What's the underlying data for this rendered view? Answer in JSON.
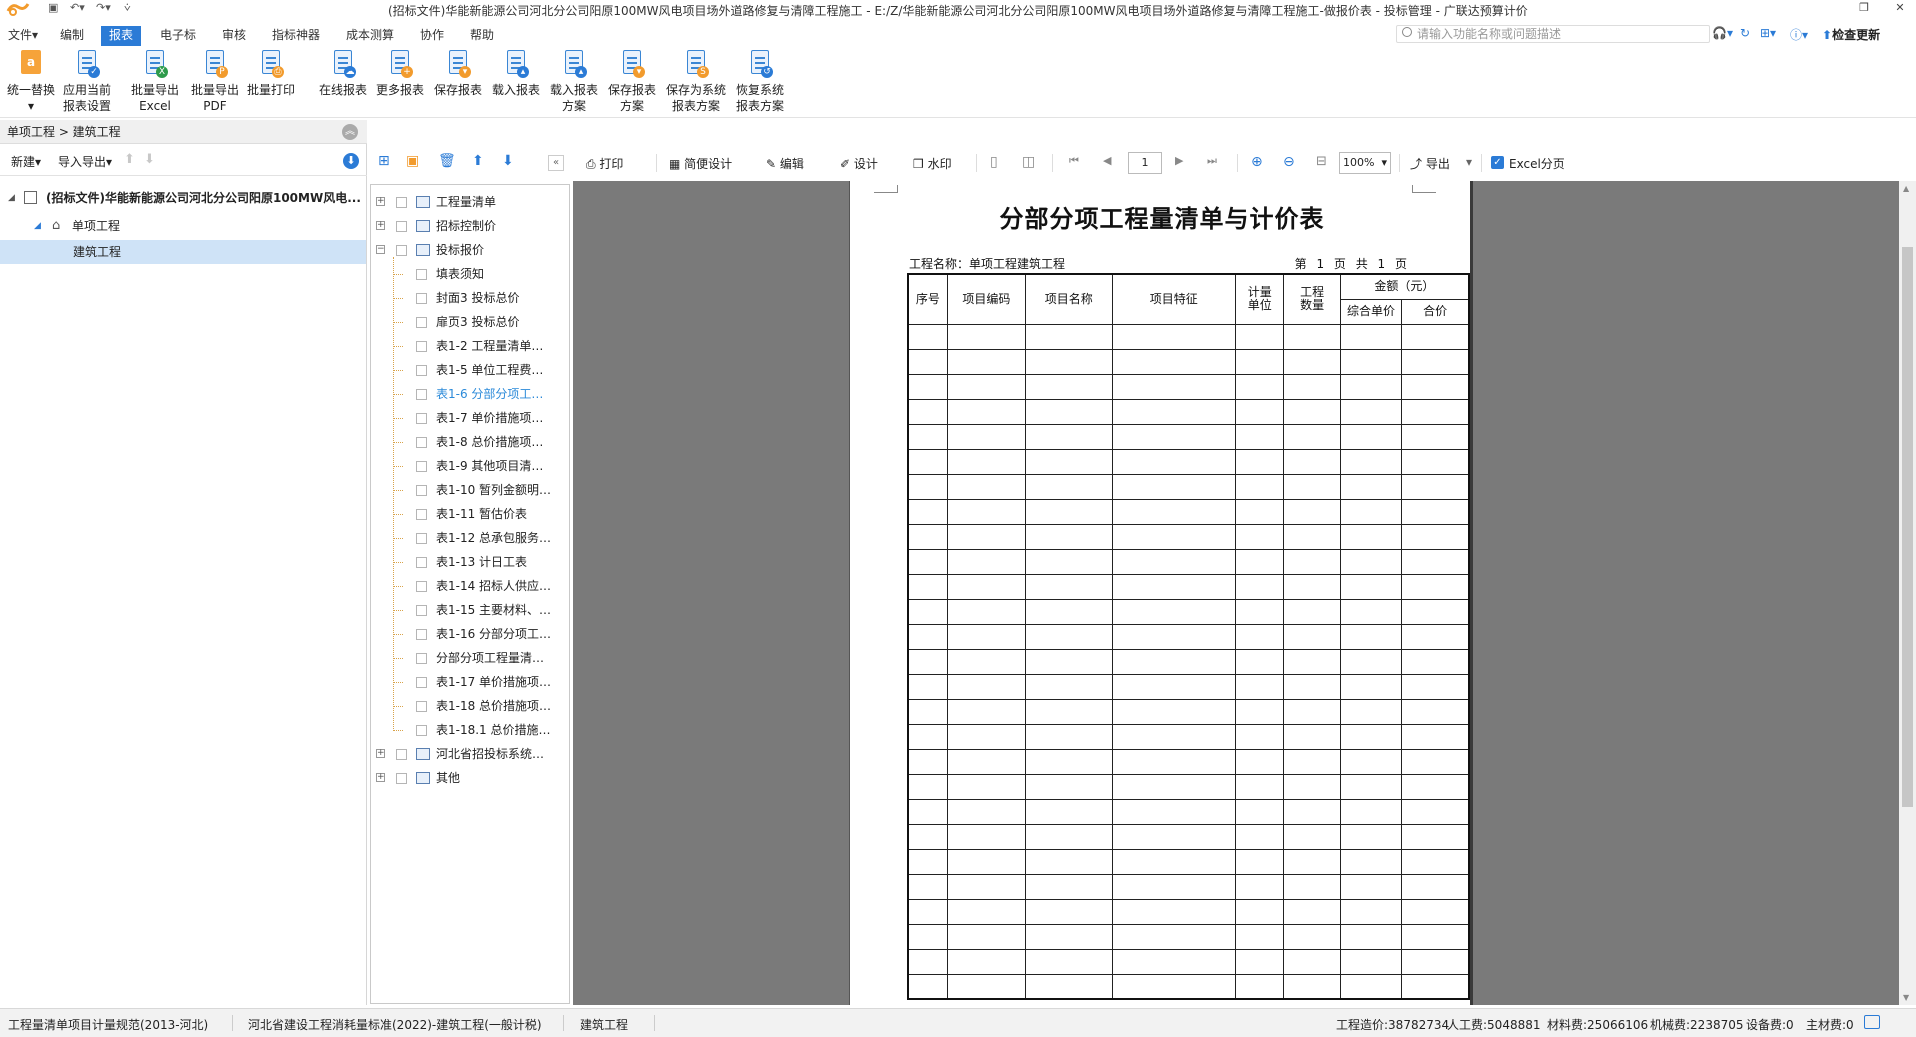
{
  "titlebar": {
    "title": "(招标文件)华能新能源公司河北分公司阳原100MW风电项目场外道路修复与清障工程施工 - E:/Z/华能新能源公司河北分公司阳原100MW风电项目场外道路修复与清障工程施工-做报价表 - 投标管理 - 广联达预算计价"
  },
  "menu": {
    "items": [
      "文件",
      "编制",
      "报表",
      "电子标",
      "审核",
      "指标神器",
      "成本测算",
      "协作",
      "帮助"
    ],
    "active_index": 2,
    "search_placeholder": "请输入功能名称或问题描述",
    "update_label": "检查更新"
  },
  "ribbon": {
    "buttons": [
      {
        "line1": "统一替换",
        "line2": "▾"
      },
      {
        "line1": "应用当前",
        "line2": "报表设置"
      },
      {
        "line1": "批量导出",
        "line2": "Excel"
      },
      {
        "line1": "批量导出",
        "line2": "PDF"
      },
      {
        "line1": "批量打印",
        "line2": ""
      },
      {
        "line1": "在线报表",
        "line2": ""
      },
      {
        "line1": "更多报表",
        "line2": ""
      },
      {
        "line1": "保存报表",
        "line2": ""
      },
      {
        "line1": "载入报表",
        "line2": ""
      },
      {
        "line1": "载入报表",
        "line2": "方案"
      },
      {
        "line1": "保存报表",
        "line2": "方案"
      },
      {
        "line1": "保存为系统",
        "line2": "报表方案"
      },
      {
        "line1": "恢复系统",
        "line2": "报表方案"
      }
    ]
  },
  "left_panel": {
    "breadcrumb": "单项工程 > 建筑工程",
    "new_label": "新建",
    "import_export_label": "导入导出",
    "tree": [
      {
        "label": "(招标文件)华能新能源公司河北分公司阳原100MW风电...",
        "level": 0
      },
      {
        "label": "单项工程",
        "level": 1
      },
      {
        "label": "建筑工程",
        "level": 2,
        "selected": true
      }
    ]
  },
  "report_tree": {
    "items": [
      {
        "label": "工程量清单",
        "type": "folder"
      },
      {
        "label": "招标控制价",
        "type": "folder"
      },
      {
        "label": "投标报价",
        "type": "folder",
        "expanded": true
      },
      {
        "label": "填表须知",
        "type": "leaf"
      },
      {
        "label": "封面3 投标总价",
        "type": "leaf"
      },
      {
        "label": "扉页3 投标总价",
        "type": "leaf"
      },
      {
        "label": "表1-2 工程量清单…",
        "type": "leaf"
      },
      {
        "label": "表1-5 单位工程费…",
        "type": "leaf"
      },
      {
        "label": "表1-6 分部分项工…",
        "type": "leaf",
        "active": true
      },
      {
        "label": "表1-7 单价措施项…",
        "type": "leaf"
      },
      {
        "label": "表1-8 总价措施项…",
        "type": "leaf"
      },
      {
        "label": "表1-9 其他项目清…",
        "type": "leaf"
      },
      {
        "label": "表1-10 暂列金额明…",
        "type": "leaf"
      },
      {
        "label": "表1-11 暂估价表",
        "type": "leaf"
      },
      {
        "label": "表1-12 总承包服务…",
        "type": "leaf"
      },
      {
        "label": "表1-13 计日工表",
        "type": "leaf"
      },
      {
        "label": "表1-14 招标人供应…",
        "type": "leaf"
      },
      {
        "label": "表1-15 主要材料、…",
        "type": "leaf"
      },
      {
        "label": "表1-16 分部分项工…",
        "type": "leaf"
      },
      {
        "label": "分部分项工程量清…",
        "type": "leaf"
      },
      {
        "label": "表1-17 单价措施项…",
        "type": "leaf"
      },
      {
        "label": "表1-18 总价措施项…",
        "type": "leaf"
      },
      {
        "label": "表1-18.1 总价措施…",
        "type": "leaf"
      },
      {
        "label": "河北省招投标系统…",
        "type": "folder"
      },
      {
        "label": "其他",
        "type": "folder"
      }
    ]
  },
  "report_toolbar": {
    "print": "打印",
    "simple_design": "简便设计",
    "edit": "编辑",
    "design": "设计",
    "watermark": "水印",
    "page": "1",
    "zoom": "100%",
    "export": "导出",
    "excel_paging": "Excel分页"
  },
  "report": {
    "title": "分部分项工程量清单与计价表",
    "project_name": "工程名称：单项工程建筑工程",
    "page_info": "第 1 页  共 1 页",
    "headers": {
      "seq": "序号",
      "code": "项目编码",
      "name": "项目名称",
      "feature": "项目特征",
      "unit": "计量单位",
      "qty": "工程数量",
      "amount": "金额（元）",
      "unit_price": "综合单价",
      "total": "合价"
    },
    "empty_rows": 27
  },
  "status": {
    "spec": "工程量清单项目计量规范(2013-河北)",
    "quota": "河北省建设工程消耗量标准(2022)-建筑工程(一般计税)",
    "project": "建筑工程",
    "cost": "工程造价:38782734",
    "labor": "人工费:5048881",
    "material": "材料费:25066106",
    "machine": "机械费:2238705",
    "equipment": "设备费:0",
    "main_material": "主材费:0"
  },
  "colors": {
    "accent": "#2b7bd6",
    "tree_active": "#2b8ad9",
    "viewer_bg": "#7a7a7a"
  }
}
